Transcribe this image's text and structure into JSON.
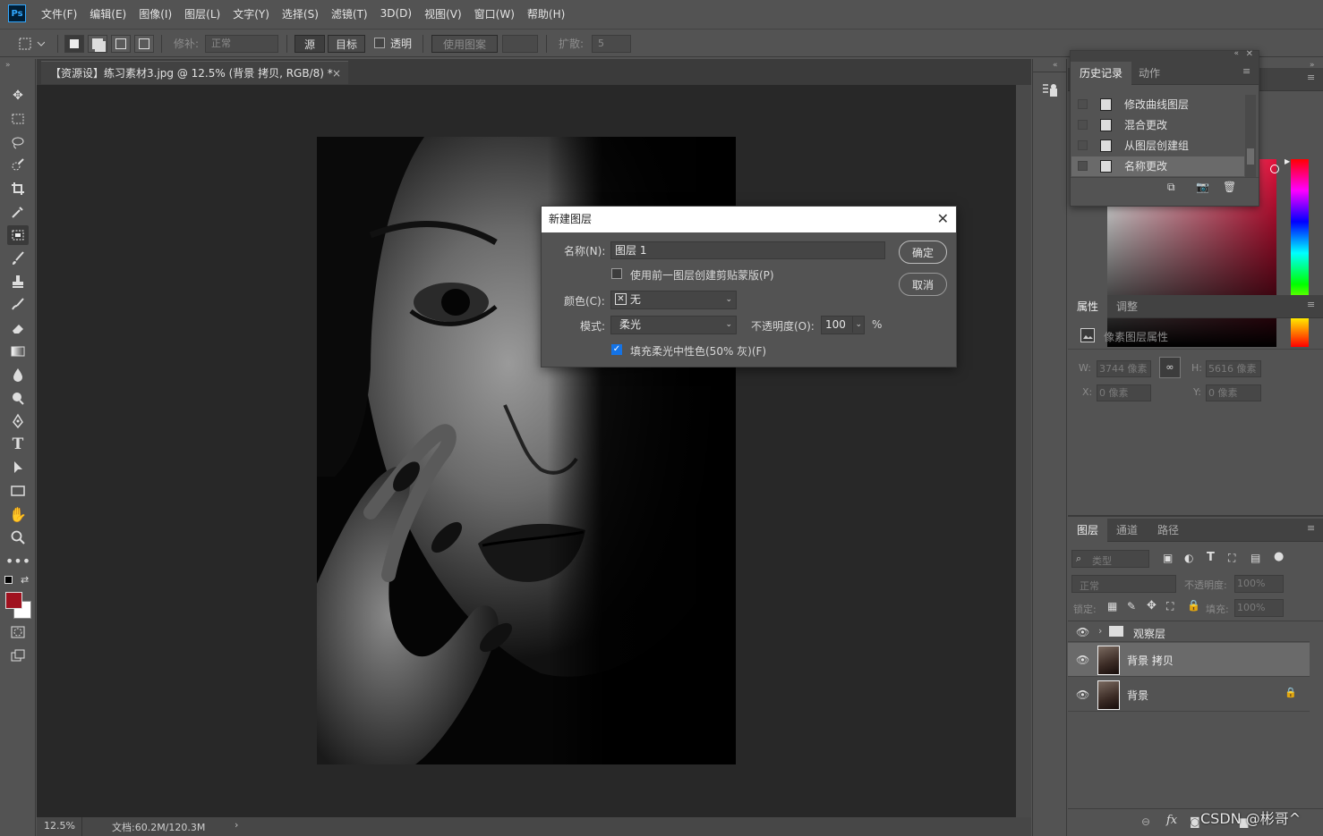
{
  "app": {
    "logo": "Ps",
    "accent": "#31a8ff"
  },
  "menu": [
    "文件(F)",
    "编辑(E)",
    "图像(I)",
    "图层(L)",
    "文字(Y)",
    "选择(S)",
    "滤镜(T)",
    "3D(D)",
    "视图(V)",
    "窗口(W)",
    "帮助(H)"
  ],
  "options": {
    "patch_label": "修补:",
    "patch_value": "正常",
    "source_btn": "源",
    "target_btn": "目标",
    "transparent_label": "透明",
    "use_pattern_btn": "使用图案",
    "diffusion_label": "扩散:",
    "diffusion_value": "5"
  },
  "document": {
    "tab_title": "【资源设】练习素材3.jpg @ 12.5% (背景 拷贝, RGB/8) *",
    "close_glyph": "×",
    "zoom": "12.5%",
    "doc_size": "文档:60.2M/120.3M",
    "status_arrow": "›"
  },
  "dialog": {
    "title": "新建图层",
    "close_glyph": "✕",
    "name_label": "名称(N):",
    "name_value": "图层 1",
    "clip_label": "使用前一图层创建剪贴蒙版(P)",
    "color_label": "颜色(C):",
    "color_value": "无",
    "mode_label": "模式:",
    "mode_value": "柔光",
    "opacity_label": "不透明度(O):",
    "opacity_value": "100",
    "opacity_unit": "%",
    "fill_label": "填充柔光中性色(50% 灰)(F)",
    "fill_checked": true,
    "ok_label": "确定",
    "cancel_label": "取消"
  },
  "history": {
    "tabs": [
      "历史记录",
      "动作"
    ],
    "items": [
      "修改曲线图层",
      "混合更改",
      "从图层创建组",
      "名称更改"
    ],
    "selected_index": 3
  },
  "properties": {
    "tabs": [
      "属性",
      "调整"
    ],
    "header": "像素图层属性",
    "w_label": "W:",
    "w_value": "3744 像素",
    "h_label": "H:",
    "h_value": "5616 像素",
    "x_label": "X:",
    "x_value": "0 像素",
    "y_label": "Y:",
    "y_value": "0 像素"
  },
  "layers": {
    "tabs": [
      "图层",
      "通道",
      "路径"
    ],
    "filter_value": "类型",
    "blend_value": "正常",
    "opacity_label": "不透明度:",
    "opacity_value": "100%",
    "lock_label": "锁定:",
    "fill_label": "填充:",
    "fill_value": "100%",
    "items": [
      {
        "name": "观察层",
        "type": "group"
      },
      {
        "name": "背景 拷贝",
        "type": "pixel",
        "selected": true
      },
      {
        "name": "背景",
        "type": "pixel",
        "locked": true
      }
    ],
    "footer_fx": "fx"
  },
  "watermark": "CSDN @彬哥^"
}
